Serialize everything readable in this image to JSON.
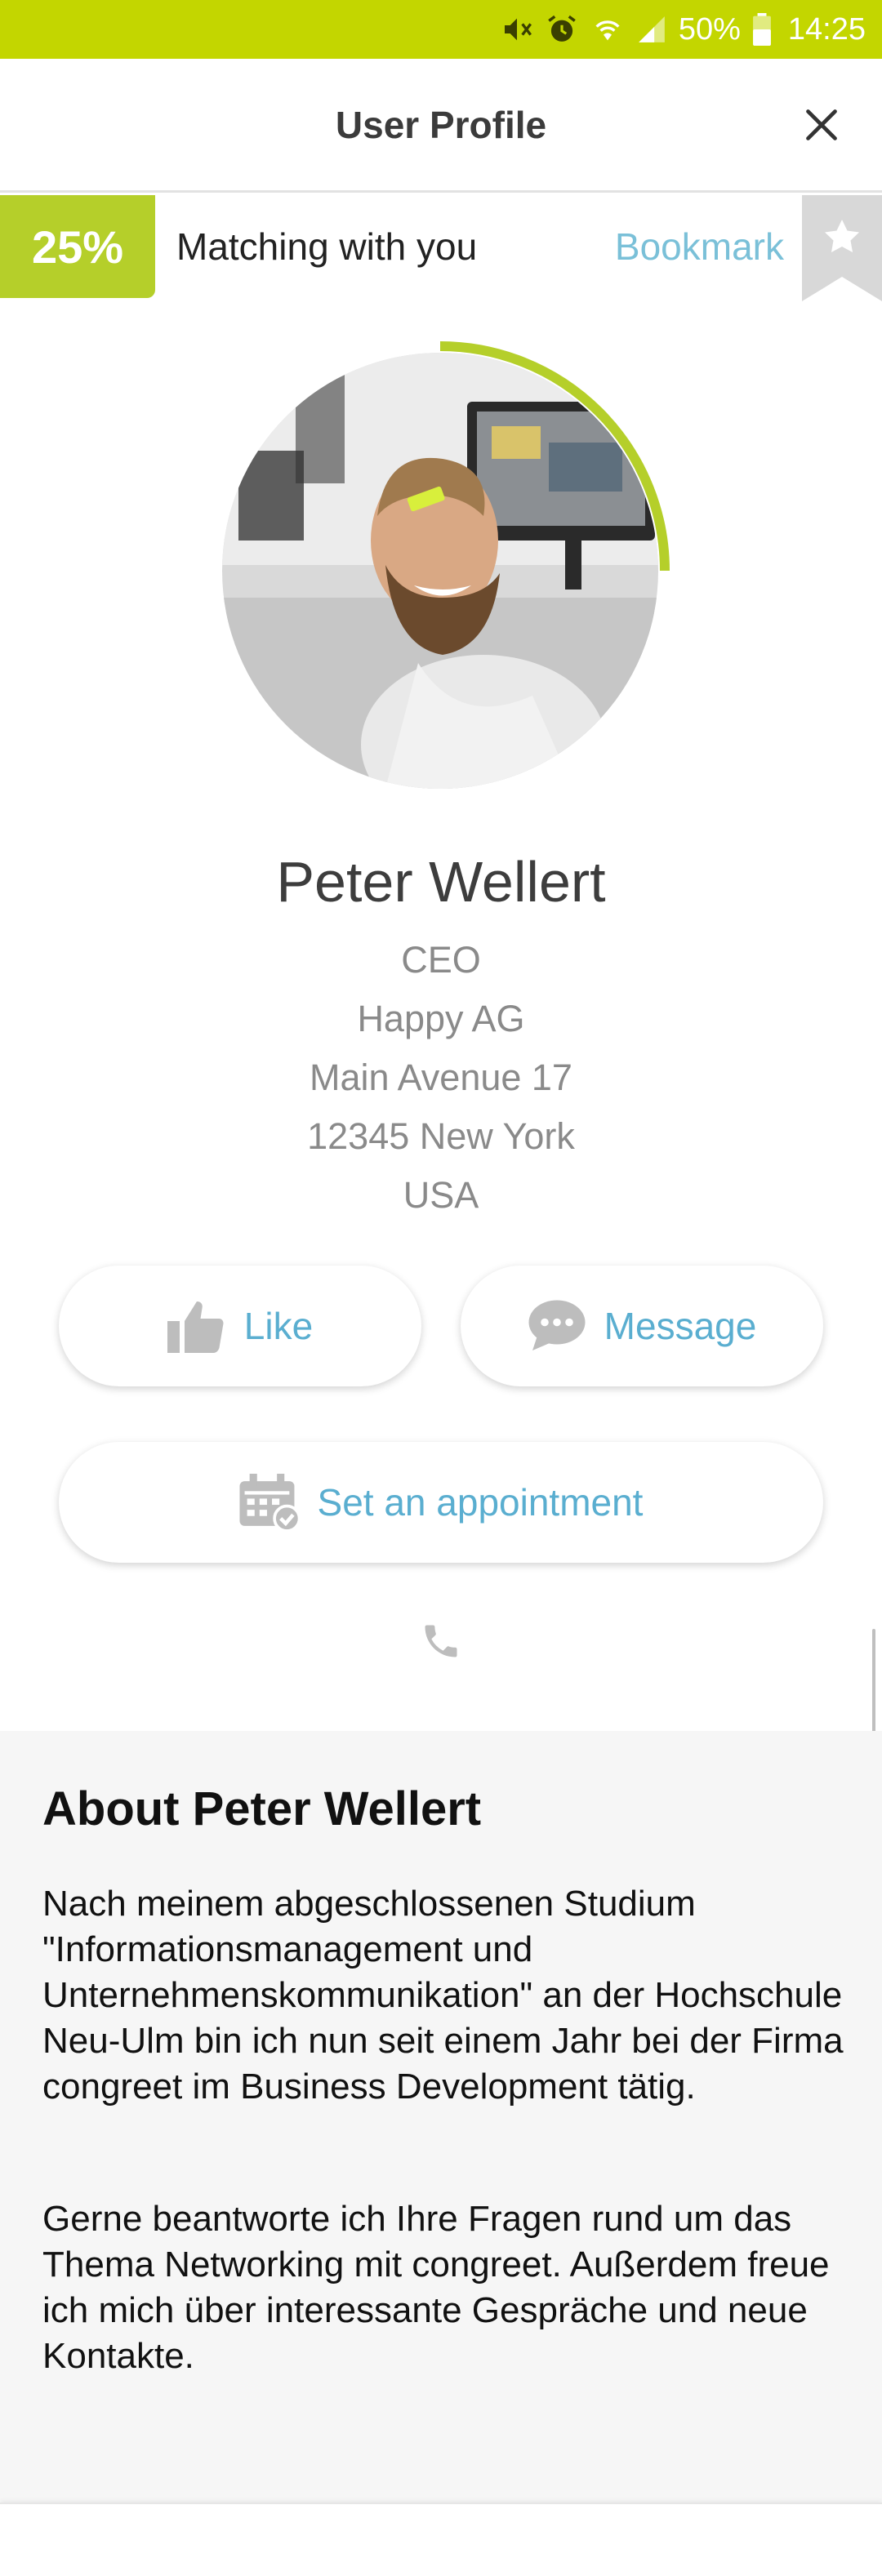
{
  "status_bar": {
    "battery": "50%",
    "time": "14:25",
    "icons": [
      "mute-icon",
      "alarm-icon",
      "wifi-icon",
      "signal-icon",
      "battery-icon"
    ]
  },
  "header": {
    "title": "User Profile",
    "close_icon": "close-icon"
  },
  "match": {
    "percent": "25%",
    "text": "Matching with you",
    "bookmark_label": "Bookmark",
    "bookmark_icon": "star-icon",
    "accent_color": "#b5cf2a"
  },
  "profile": {
    "name": "Peter Wellert",
    "position": "CEO",
    "company": "Happy AG",
    "street": "Main Avenue 17",
    "city": "12345 New York",
    "country": "USA",
    "match_ring_fraction": 0.25
  },
  "actions": {
    "like_label": "Like",
    "like_icon": "thumbs-up-icon",
    "message_label": "Message",
    "message_icon": "chat-bubble-icon",
    "appointment_label": "Set an appointment",
    "appointment_icon": "calendar-icon",
    "phone_icon": "phone-icon",
    "link_color": "#5aaed0"
  },
  "about": {
    "title": "About Peter Wellert",
    "paragraph1": "Nach meinem abgeschlossenen Studium \"Informationsmanagement und Unternehmenskommunikation\" an der Hochschule Neu-Ulm bin ich nun seit einem Jahr bei der Firma congreet im Business Development tätig.",
    "paragraph2": "Gerne beantworte ich Ihre Fragen rund um das Thema Networking mit congreet. Außerdem freue ich mich über interessante Gespräche und neue Kontakte."
  }
}
